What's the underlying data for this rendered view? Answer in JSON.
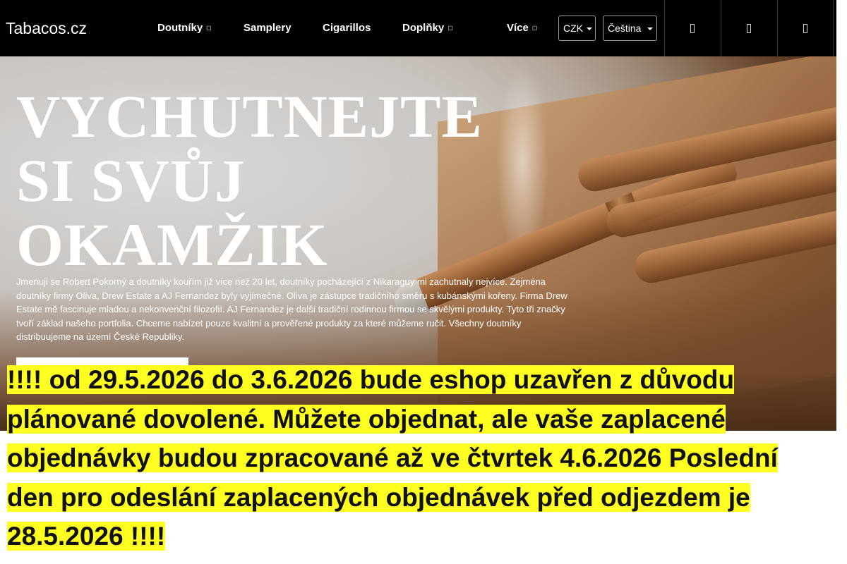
{
  "header": {
    "logo": "Tabacos.cz",
    "nav": [
      {
        "label": "Doutníky",
        "has_dropdown": true
      },
      {
        "label": "Samplery",
        "has_dropdown": false
      },
      {
        "label": "Cigarillos",
        "has_dropdown": false
      },
      {
        "label": "Doplňky",
        "has_dropdown": true
      },
      {
        "label": "Více",
        "has_dropdown": true
      }
    ],
    "currency": "CZK",
    "language": "Čeština",
    "icons": [
      "search-icon",
      "user-icon",
      "cart-icon"
    ]
  },
  "hero": {
    "title_lines": [
      "VYCHUTNEJTE",
      "SI SVŮJ",
      "OKAMŽIK"
    ],
    "text": "Jmenuji se Robert Pokorný a doutníky kouřím již více než 20 let, doutníky pocházející z Nikaraguy mi zachutnaly nejvíce. Zejména doutníky firmy Oliva, Drew Estate a AJ Fernandez byly vyjímečné. Oliva je zástupce tradičního směru s kubánskými kořeny. Firma Drew Estate mě fascinuje mladou a nekonvenční filozofií. AJ Fernandez je další tradiční rodinnou firmou se skvělými produkty. Tyto tři značky tvoří základ našeho portfolia. Chceme nabízet pouze kvalitní a prověřené produkty za které můžeme ručit. Všechny doutníky distribuujeme na území České Republiky."
  },
  "notice": {
    "text": "!!!! od 29.5.2026 do 3.6.2026 bude eshop uzavřen z důvodu plánované dovolené. Můžete objednat, ale vaše zaplacené objednávky budou zpracované až ve čtvrtek 4.6.2026 Poslední den pro odeslání zaplacených objednávek před odjezdem je 28.5.2026 !!!!",
    "highlight_color": "#ffff22"
  },
  "colors": {
    "header_bg": "#000000",
    "text_light": "#ffffff"
  }
}
